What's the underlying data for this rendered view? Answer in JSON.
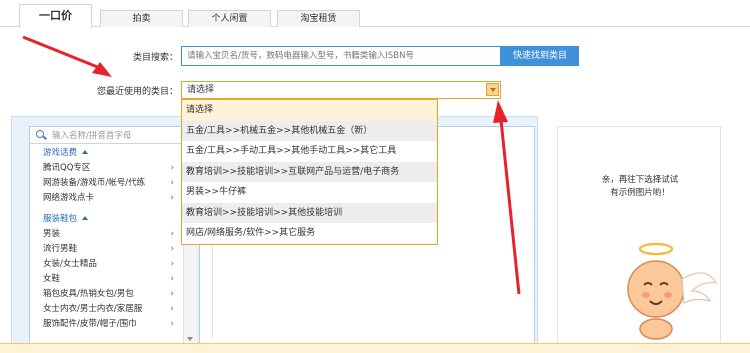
{
  "tabs": [
    {
      "label": "一口价",
      "active": true
    },
    {
      "label": "拍卖",
      "active": false
    },
    {
      "label": "个人闲置",
      "active": false
    },
    {
      "label": "淘宝租赁",
      "active": false
    }
  ],
  "search": {
    "label": "类目搜索：",
    "placeholder": "请输入宝贝名/货号，数码电器输入型号，书籍类输入ISBN号",
    "button_label": "快速找到类目"
  },
  "recent": {
    "label": "您最近使用的类目：",
    "selected": "请选择",
    "options": [
      "请选择",
      "五金/工具>>机械五金>>其他机械五金（新）",
      "五金/工具>>手动工具>>其他手动工具>>其它工具",
      "教育培训>>技能培训>>互联网产品与运营/电子商务",
      "男装>>牛仔裤",
      "教育培训>>技能培训>>其他技能培训",
      "网店/网络服务/软件>>其它服务"
    ]
  },
  "category_panel": {
    "search_placeholder": "输入名称/拼音首字母",
    "groups": [
      {
        "title": "游戏话费",
        "items": [
          "腾讯QQ专区",
          "网游装备/游戏币/帐号/代练",
          "网络游戏点卡"
        ]
      },
      {
        "title": "服装鞋包",
        "items": [
          "男装",
          "流行男鞋",
          "女装/女士精品",
          "女鞋",
          "箱包皮具/热销女包/男包",
          "女士内衣/男士内衣/家居服",
          "服饰配件/皮带/帽子/围巾"
        ]
      }
    ]
  },
  "hint": {
    "line1": "亲，再往下选择试试",
    "line2": "有示例图片哟！"
  },
  "colors": {
    "accent_blue": "#3f91d9",
    "select_border": "#e3a52f",
    "arrow_red": "#e8222a"
  }
}
